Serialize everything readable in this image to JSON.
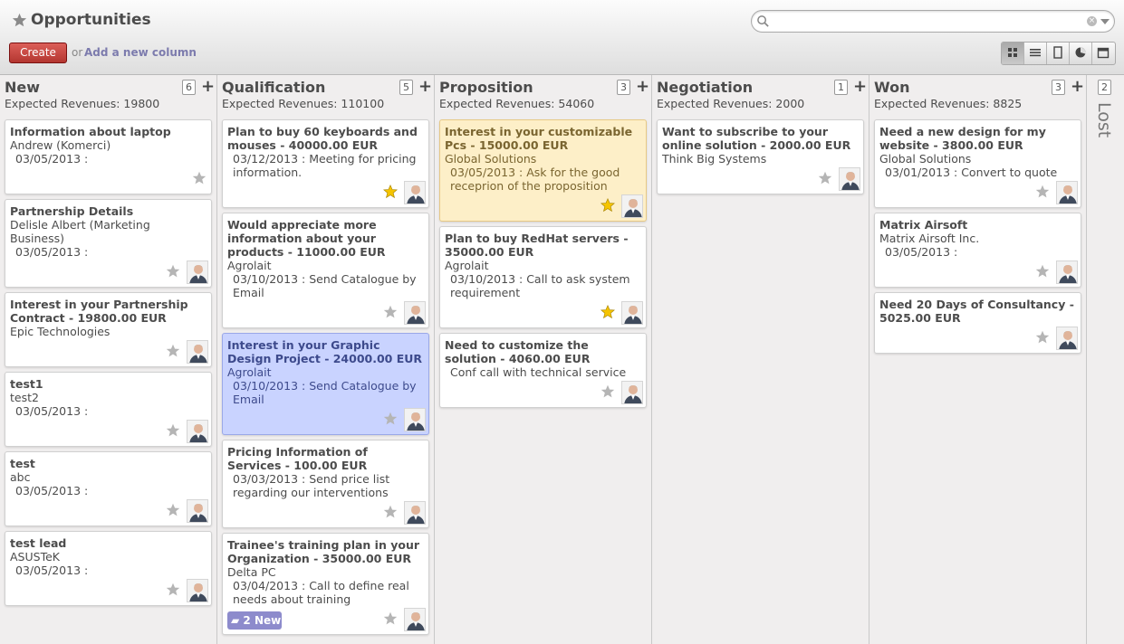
{
  "header": {
    "title": "Opportunities",
    "search_placeholder": "",
    "create_label": "Create",
    "or_label": "or",
    "add_column_label": "Add a new column",
    "views": [
      "kanban-icon",
      "list-icon",
      "form-icon",
      "graph-icon",
      "calendar-icon"
    ],
    "active_view": "kanban-icon"
  },
  "colors": {
    "accent": "#7c7bad",
    "create_button": "#c0403a",
    "starred": "#f5c400",
    "unstarred": "#b5b5b5",
    "highlight_yellow": "#fdefc8",
    "highlight_blue": "#c9d3ff"
  },
  "columns": [
    {
      "title": "New",
      "count": "6",
      "revenue": "Expected Revenues: 19800",
      "cards": [
        {
          "title": "Information about laptop",
          "partner": "Andrew (Komerci)",
          "date": "03/05/2013 :",
          "starred": false,
          "avatar": false
        },
        {
          "title": "Partnership Details",
          "partner": "Delisle Albert (Marketing Business)",
          "date": "03/05/2013 :",
          "starred": false,
          "avatar": true
        },
        {
          "title": "Interest in your Partnership Contract - 19800.00 EUR",
          "partner": "Epic Technologies",
          "date": "",
          "starred": false,
          "avatar": true
        },
        {
          "title": "test1",
          "partner": "test2",
          "date": "03/05/2013 :",
          "starred": false,
          "avatar": true
        },
        {
          "title": "test",
          "partner": "abc",
          "date": "03/05/2013 :",
          "starred": false,
          "avatar": true
        },
        {
          "title": "test lead",
          "partner": "ASUSTeK",
          "date": "03/05/2013 :",
          "starred": false,
          "avatar": true
        }
      ]
    },
    {
      "title": "Qualification",
      "count": "5",
      "revenue": "Expected Revenues: 110100",
      "cards": [
        {
          "title": "Plan to buy 60 keyboards and mouses - 40000.00 EUR",
          "partner": "",
          "date": "03/12/2013 : Meeting for pricing information.",
          "starred": true,
          "avatar": true
        },
        {
          "title": "Would appreciate more information about your products - 11000.00 EUR",
          "partner": "Agrolait",
          "date": "03/10/2013 : Send Catalogue by Email",
          "starred": false,
          "avatar": true
        },
        {
          "title": "Interest in your Graphic Design Project - 24000.00 EUR",
          "partner": "Agrolait",
          "date": "03/10/2013 : Send Catalogue by Email",
          "starred": false,
          "avatar": true,
          "color": "blue"
        },
        {
          "title": "Pricing Information of Services - 100.00 EUR",
          "partner": "",
          "date": "03/03/2013 : Send price list regarding our interventions",
          "starred": false,
          "avatar": true
        },
        {
          "title": "Trainee's training plan in your Organization - 35000.00 EUR",
          "partner": "Delta PC",
          "date": "03/04/2013 : Call to define real needs about training",
          "starred": false,
          "avatar": true,
          "badge": "2 New"
        }
      ]
    },
    {
      "title": "Proposition",
      "count": "3",
      "revenue": "Expected Revenues: 54060",
      "cards": [
        {
          "title": "Interest in your customizable Pcs - 15000.00 EUR",
          "partner": "Global Solutions",
          "date": "03/05/2013 : Ask for the good receprion of the proposition",
          "starred": true,
          "avatar": true,
          "color": "yellow"
        },
        {
          "title": "Plan to buy RedHat servers - 35000.00 EUR",
          "partner": "Agrolait",
          "date": "03/10/2013 : Call to ask system requirement",
          "starred": true,
          "avatar": true
        },
        {
          "title": "Need to customize the solution - 4060.00 EUR",
          "partner": "",
          "date": "Conf call with technical service",
          "starred": false,
          "avatar": true
        }
      ]
    },
    {
      "title": "Negotiation",
      "count": "1",
      "revenue": "Expected Revenues: 2000",
      "cards": [
        {
          "title": "Want to subscribe to your online solution - 2000.00 EUR",
          "partner": "Think Big Systems",
          "date": "",
          "starred": false,
          "avatar": true
        }
      ]
    },
    {
      "title": "Won",
      "count": "3",
      "revenue": "Expected Revenues: 8825",
      "cards": [
        {
          "title": "Need a new design for my website - 3800.00 EUR",
          "partner": "Global Solutions",
          "date": "03/01/2013 : Convert to quote",
          "starred": false,
          "avatar": true
        },
        {
          "title": "Matrix Airsoft",
          "partner": "Matrix Airsoft Inc.",
          "date": "03/05/2013 :",
          "starred": false,
          "avatar": true
        },
        {
          "title": "Need 20 Days of Consultancy - 5025.00 EUR",
          "partner": "",
          "date": "",
          "starred": false,
          "avatar": true
        }
      ]
    }
  ],
  "lost": {
    "title": "Lost",
    "count": "2"
  }
}
